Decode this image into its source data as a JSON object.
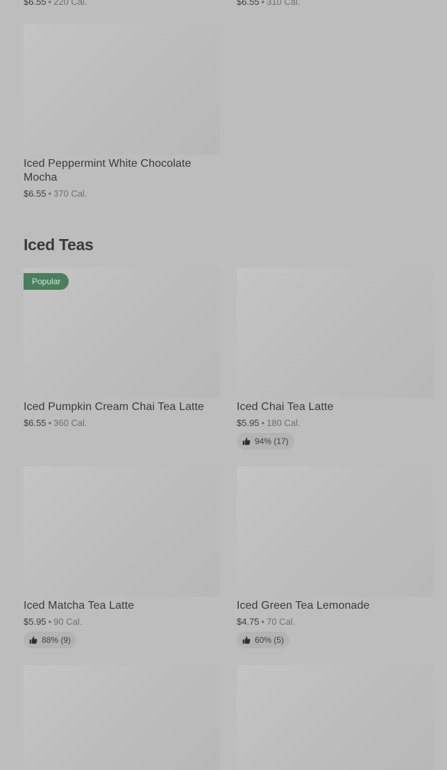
{
  "top_items": [
    {
      "price": "$6.55",
      "calories": "220 Cal."
    },
    {
      "price": "$6.55",
      "calories": "310 Cal."
    }
  ],
  "peppermint": {
    "title": "Iced Peppermint White Chocolate Mocha",
    "price": "$6.55",
    "calories": "370 Cal."
  },
  "section": {
    "title": "Iced Teas"
  },
  "badge_popular": "Popular",
  "teas": [
    {
      "title": "Iced Pumpkin Cream Chai Tea Latte",
      "price": "$6.55",
      "calories": "360 Cal.",
      "rating": ""
    },
    {
      "title": "Iced Chai Tea Latte",
      "price": "$5.95",
      "calories": "180 Cal.",
      "rating": "94% (17)"
    },
    {
      "title": "Iced Matcha Tea Latte",
      "price": "$5.95",
      "calories": "90 Cal.",
      "rating": "88% (9)"
    },
    {
      "title": "Iced Green Tea Lemonade",
      "price": "$4.75",
      "calories": "70 Cal.",
      "rating": "60% (5)"
    }
  ],
  "separator": "•",
  "colors": {
    "overlay": "#bdbdbd",
    "badge": "#4a7e5d",
    "rating_pill": "#b3b3b3"
  },
  "icons": {
    "rating": "thumbs-up-icon"
  }
}
